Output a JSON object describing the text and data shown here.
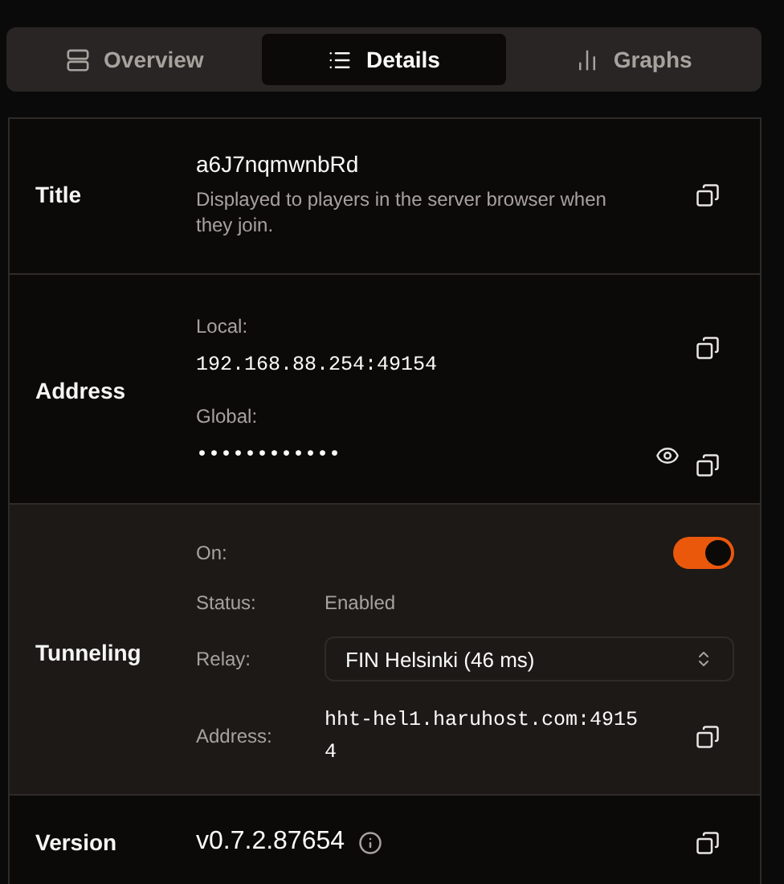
{
  "tabs": [
    {
      "label": "Overview",
      "selected": false
    },
    {
      "label": "Details",
      "selected": true
    },
    {
      "label": "Graphs",
      "selected": false
    }
  ],
  "rows": [
    {
      "kind": "title",
      "label": "Title",
      "value": "a6J7nqmwnbRd",
      "description": "Displayed to players in the server browser when they join.",
      "highlighted": false
    },
    {
      "kind": "address",
      "label": "Address",
      "local_label": "Local:",
      "local_value": "192.168.88.254:49154",
      "global_label": "Global:",
      "global_value": "••••••••••••",
      "highlighted": false
    },
    {
      "kind": "tunneling",
      "label": "Tunneling",
      "highlighted": true,
      "on_label": "On:",
      "on": true,
      "status_label": "Status:",
      "status_value": "Enabled",
      "relay_label": "Relay:",
      "relay_value": "FIN Helsinki (46 ms)",
      "address_label": "Address:",
      "address_value": "hht-hel1.haruhost.com:49154"
    },
    {
      "kind": "version",
      "label": "Version",
      "value": "v0.7.2.87654",
      "highlighted": false
    }
  ]
}
